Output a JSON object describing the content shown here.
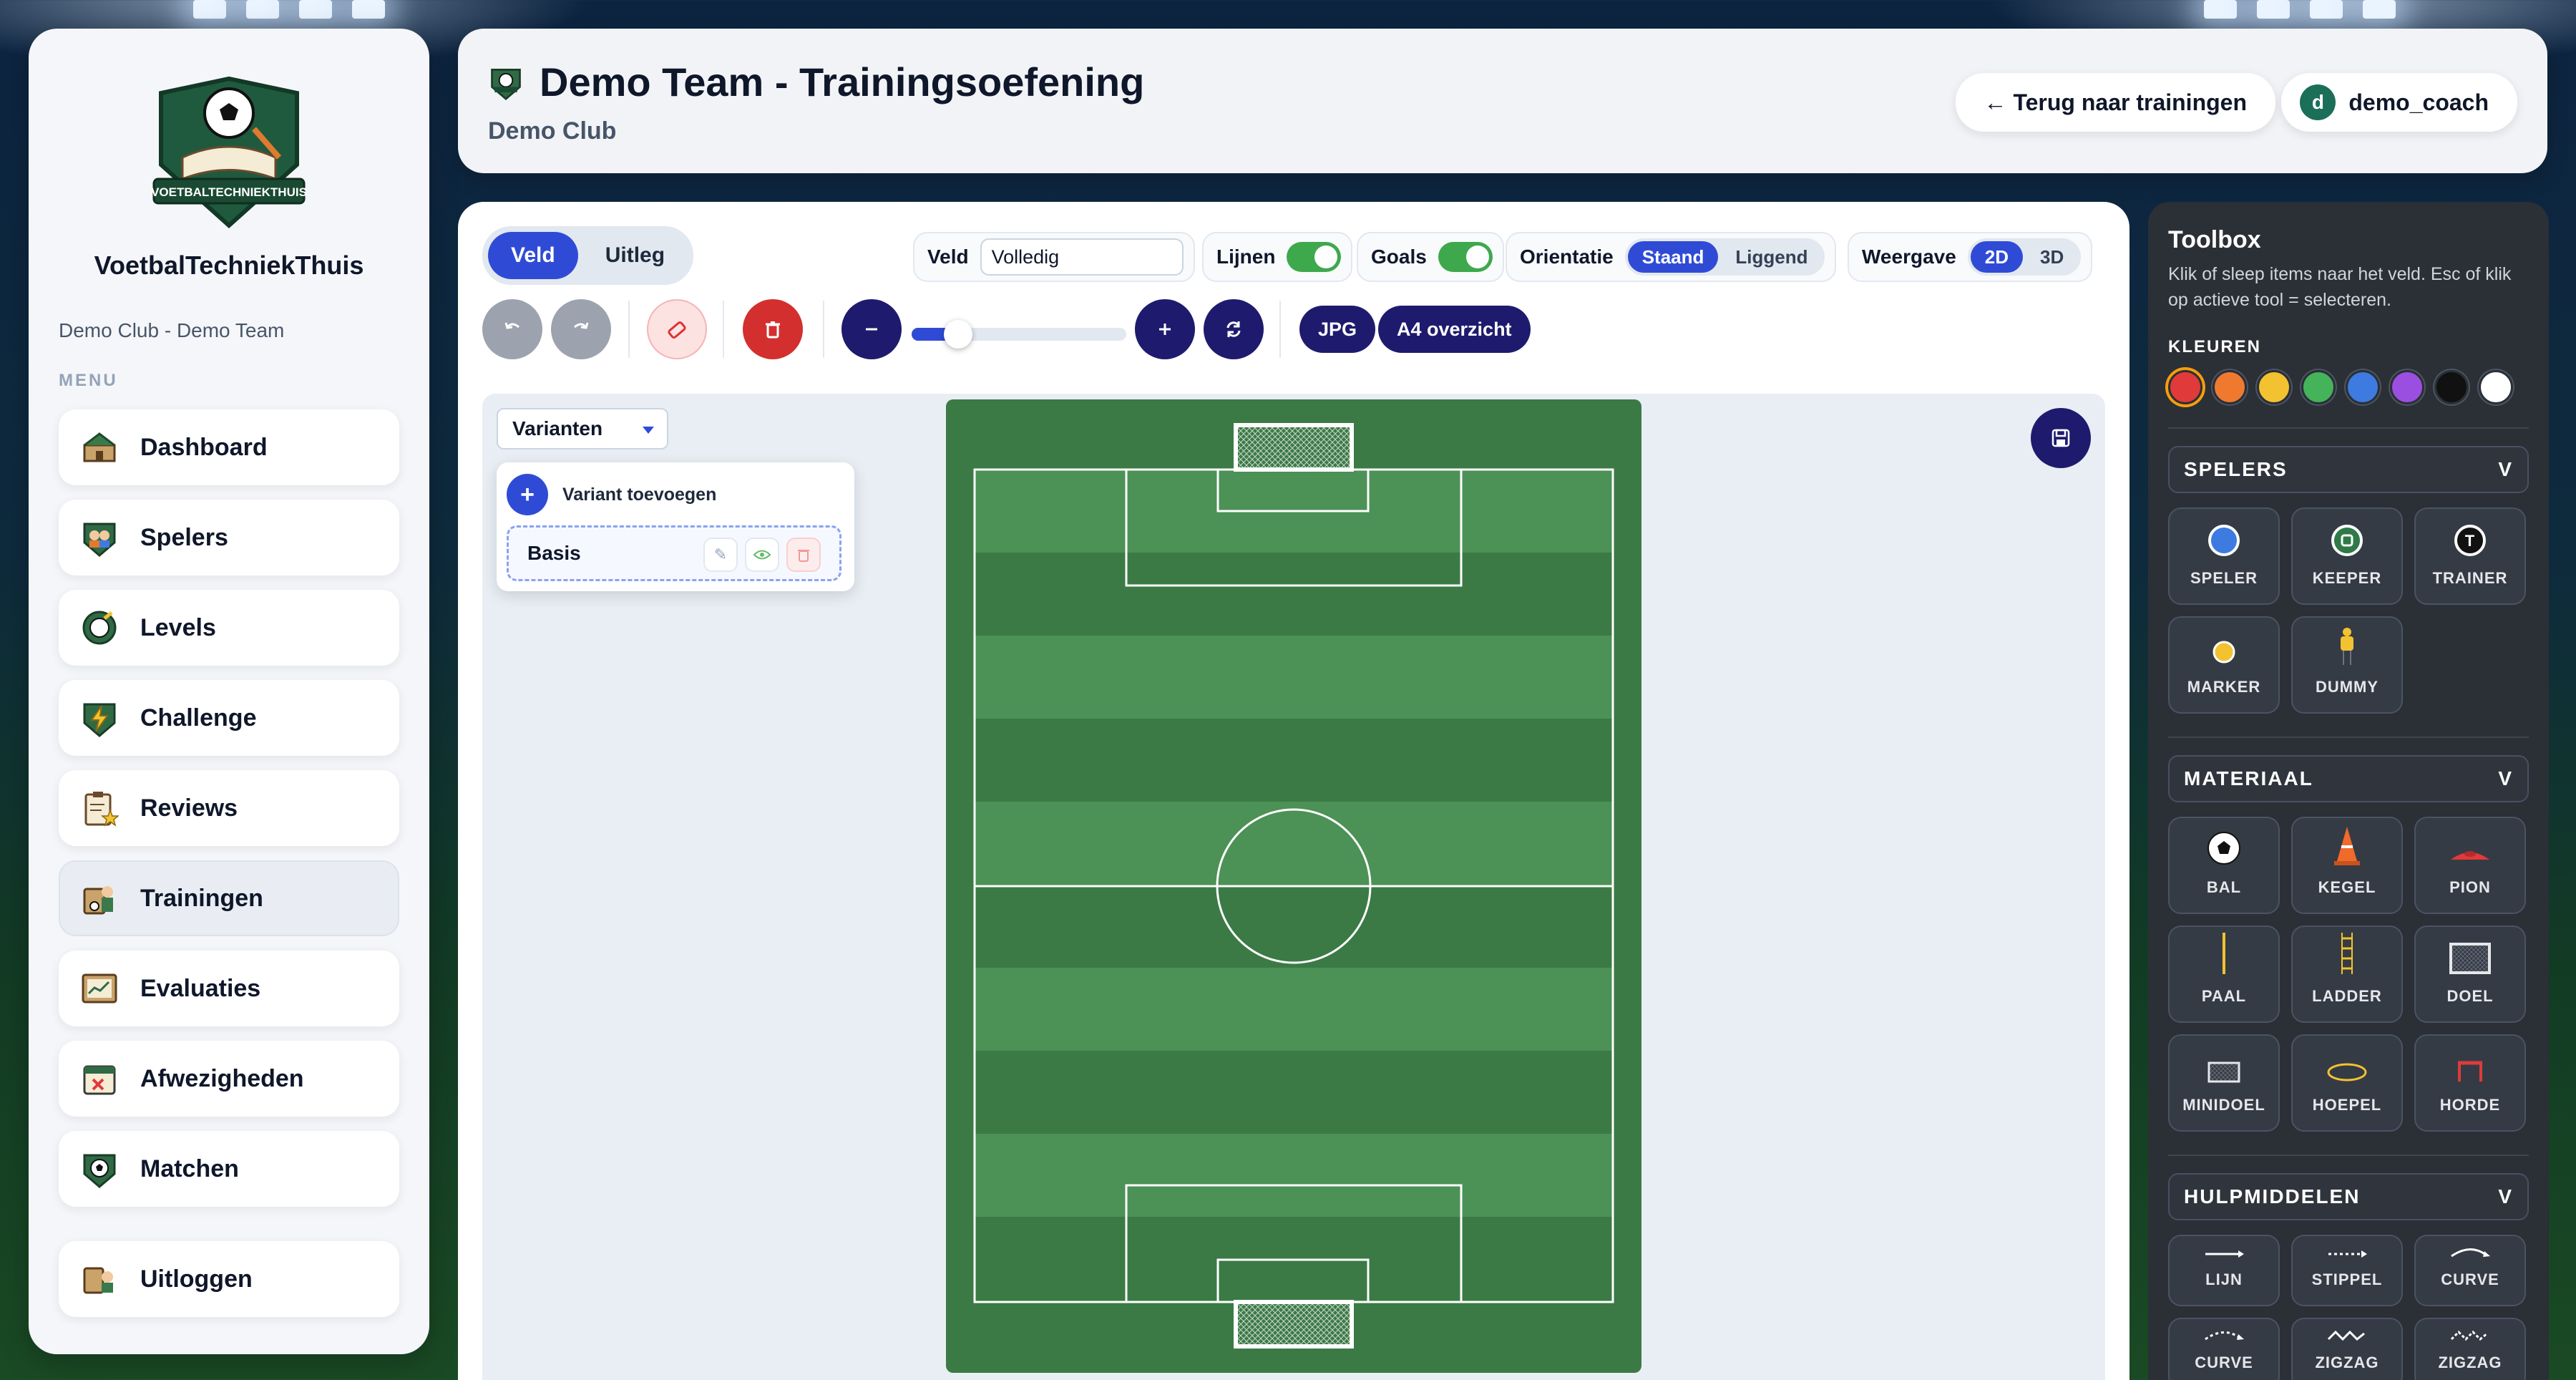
{
  "sidebar": {
    "brand": "VoetbalTechniekThuis",
    "logo_text": "VOETBALTECHNIEKTHUIS",
    "club_team": "Demo Club - Demo Team",
    "menu_title": "MENU",
    "items": [
      {
        "label": "Dashboard",
        "icon": "stadium-icon"
      },
      {
        "label": "Spelers",
        "icon": "players-icon"
      },
      {
        "label": "Levels",
        "icon": "levels-icon"
      },
      {
        "label": "Challenge",
        "icon": "lightning-shield-icon"
      },
      {
        "label": "Reviews",
        "icon": "clipboard-star-icon"
      },
      {
        "label": "Trainingen",
        "icon": "training-icon"
      },
      {
        "label": "Evaluaties",
        "icon": "chart-board-icon"
      },
      {
        "label": "Afwezigheden",
        "icon": "calendar-x-icon"
      },
      {
        "label": "Matchen",
        "icon": "ball-shield-icon"
      }
    ],
    "active": "Trainingen",
    "logout": "Uitloggen"
  },
  "header": {
    "title": "Demo Team - Trainingsoefening",
    "subtitle": "Demo Club",
    "back_button": "← Terug naar trainingen",
    "user_initial": "d",
    "user_name": "demo_coach"
  },
  "editor": {
    "tabs": [
      "Veld",
      "Uitleg"
    ],
    "active_tab": "Veld",
    "veld_label": "Veld",
    "veld_value": "Volledig",
    "lijnen_label": "Lijnen",
    "lijnen_on": true,
    "goals_label": "Goals",
    "goals_on": true,
    "orientatie_label": "Orientatie",
    "orientatie_options": [
      "Staand",
      "Liggend"
    ],
    "orientatie_selected": "Staand",
    "weergave_label": "Weergave",
    "weergave_options": [
      "2D",
      "3D"
    ],
    "weergave_selected": "2D",
    "export_jpg": "JPG",
    "export_a4": "A4 overzicht",
    "zoom_percent": 15
  },
  "variants": {
    "dropdown_label": "Varianten",
    "add_label": "Variant toevoegen",
    "items": [
      "Basis"
    ]
  },
  "toolbox": {
    "title": "Toolbox",
    "help": "Klik of sleep items naar het veld. Esc of klik op actieve tool = selecteren.",
    "colors_label": "KLEUREN",
    "colors": [
      "#e03a3a",
      "#ef7a2f",
      "#f2c230",
      "#44b35a",
      "#3d7be0",
      "#9b4fe0",
      "#111111",
      "#ffffff"
    ],
    "selected_color": "#e03a3a",
    "sections": {
      "spelers": {
        "title": "SPELERS",
        "toggle": "V",
        "items": [
          "SPELER",
          "KEEPER",
          "TRAINER",
          "MARKER",
          "DUMMY"
        ]
      },
      "materiaal": {
        "title": "MATERIAAL",
        "toggle": "V",
        "items": [
          "BAL",
          "KEGEL",
          "PION",
          "PAAL",
          "LADDER",
          "DOEL",
          "MINIDOEL",
          "HOEPEL",
          "HORDE"
        ]
      },
      "hulpmiddelen": {
        "title": "HULPMIDDELEN",
        "toggle": "V",
        "items": [
          "LIJN",
          "STIPPEL",
          "CURVE",
          "CURVE",
          "ZIGZAG",
          "ZIGZAG"
        ]
      }
    },
    "trainer_marker_letter": "T"
  }
}
